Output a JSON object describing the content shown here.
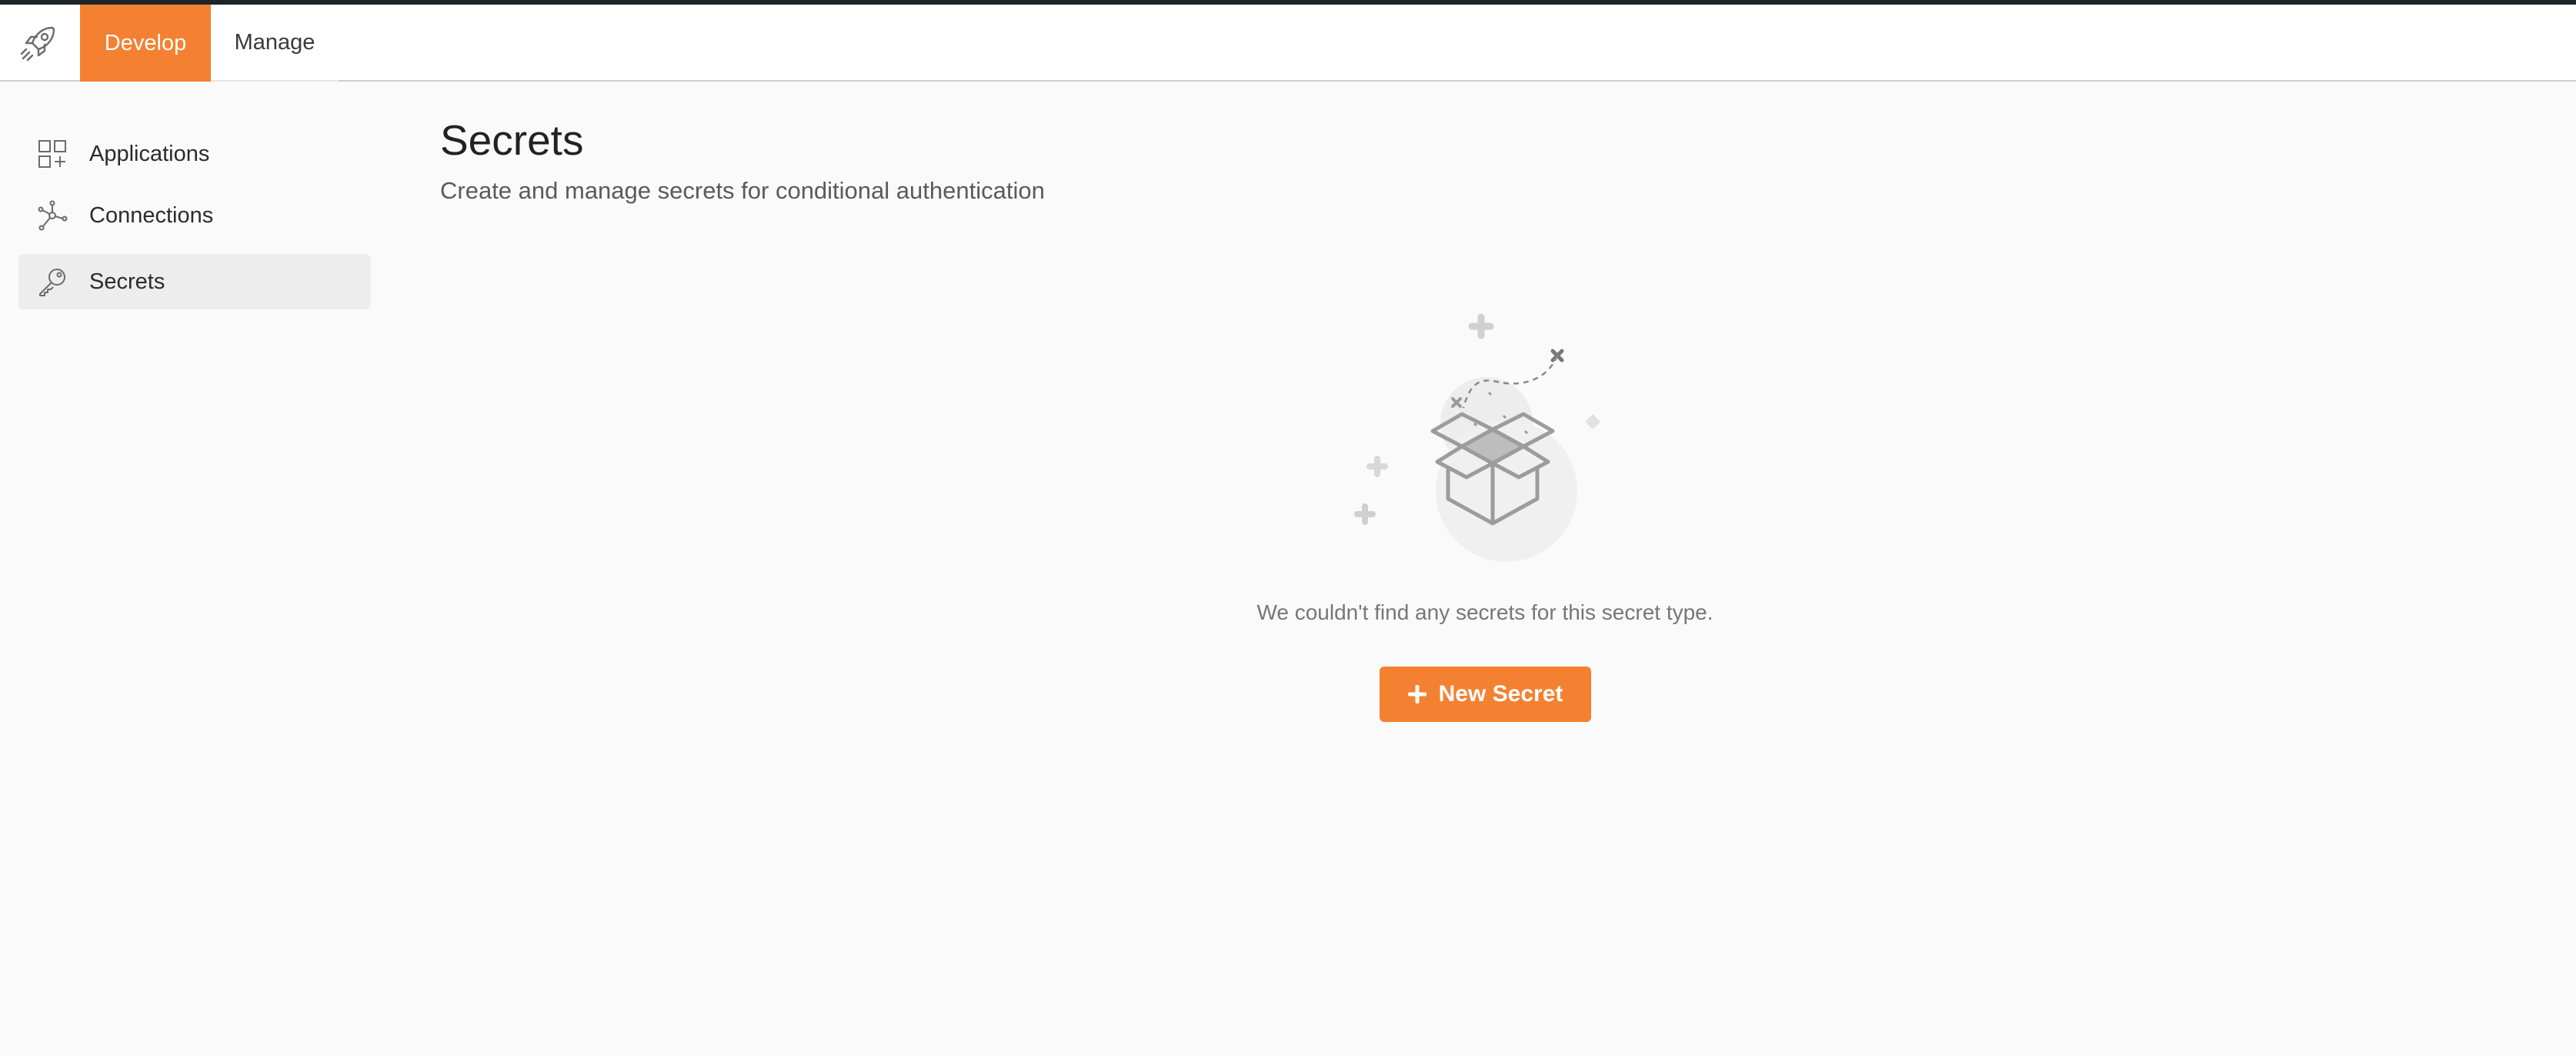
{
  "topnav": {
    "logo_icon": "rocket-icon",
    "tabs": [
      {
        "label": "Develop",
        "active": true
      },
      {
        "label": "Manage",
        "active": false
      }
    ],
    "accent_color": "#f48131"
  },
  "sidebar": {
    "items": [
      {
        "label": "Applications",
        "icon": "applications-grid-icon",
        "active": false
      },
      {
        "label": "Connections",
        "icon": "connections-network-icon",
        "active": false
      },
      {
        "label": "Secrets",
        "icon": "key-icon",
        "active": true
      }
    ]
  },
  "main": {
    "title": "Secrets",
    "subtitle": "Create and manage secrets for conditional authentication",
    "empty_state": {
      "illustration": "open-box-illustration",
      "message": "We couldn't find any secrets for this secret type.",
      "button_label": "New Secret",
      "button_icon": "plus-icon"
    }
  }
}
